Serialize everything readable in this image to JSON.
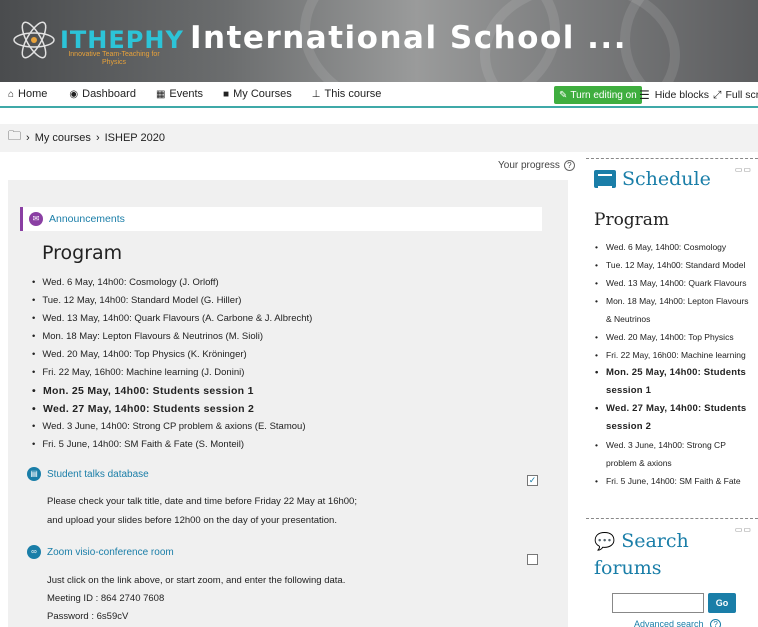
{
  "header": {
    "logo_text": "ITHEPHY",
    "logo_sub": "Innovative Team-Teaching for Physics",
    "site_title": "International School ..."
  },
  "navbar": {
    "items": [
      {
        "label": "Home",
        "icon": "home-icon"
      },
      {
        "label": "Dashboard",
        "icon": "dashboard-icon"
      },
      {
        "label": "Events",
        "icon": "calendar-icon"
      },
      {
        "label": "My Courses",
        "icon": "briefcase-icon"
      },
      {
        "label": "This course",
        "icon": "sitemap-icon"
      }
    ],
    "edit_button": "Turn editing on",
    "hide_blocks": "Hide blocks",
    "full_screen": "Full screen"
  },
  "breadcrumb": {
    "items": [
      "My courses",
      "ISHEP 2020"
    ]
  },
  "progress_label": "Your progress",
  "announcements": {
    "label": "Announcements"
  },
  "program": {
    "title": "Program",
    "items": [
      {
        "text": "Wed. 6 May, 14h00: Cosmology (J. Orloff)",
        "bold": false
      },
      {
        "text": "Tue. 12 May, 14h00: Standard Model (G. Hiller)",
        "bold": false
      },
      {
        "text": "Wed. 13 May, 14h00: Quark Flavours (A. Carbone & J. Albrecht)",
        "bold": false
      },
      {
        "text": "Mon. 18 May: Lepton Flavours & Neutrinos (M. Sioli)",
        "bold": false
      },
      {
        "text": "Wed. 20 May, 14h00: Top Physics (K. Kröninger)",
        "bold": false
      },
      {
        "text": "Fri. 22 May, 16h00: Machine learning (J. Donini)",
        "bold": false
      },
      {
        "text": "Mon. 25 May, 14h00: Students session 1",
        "bold": true
      },
      {
        "text": "Wed. 27 May, 14h00: Students session 2",
        "bold": true
      },
      {
        "text": "Wed. 3 June, 14h00: Strong CP problem & axions (E. Stamou)",
        "bold": false
      },
      {
        "text": "Fri. 5 June, 14h00: SM Faith & Fate (S. Monteil)",
        "bold": false
      }
    ]
  },
  "student_talks": {
    "label": "Student talks database",
    "text1": "Please check your talk title, date and time before Friday 22 May at 16h00;",
    "text2": "and upload your slides before 12h00 on the day of your presentation.",
    "completed": true
  },
  "zoom": {
    "label": "Zoom visio-conference room",
    "text1": "Just click on the link above, or start zoom, and enter the following data.",
    "meeting": "Meeting ID : 864 2740 7608",
    "password": "Password : 6s59cV",
    "completed": false
  },
  "schedule": {
    "title": "Schedule",
    "program_title": "Program",
    "items": [
      {
        "text": "Wed. 6 May, 14h00: Cosmology",
        "bold": false
      },
      {
        "text": "Tue. 12 May, 14h00: Standard Model",
        "bold": false
      },
      {
        "text": "Wed. 13 May, 14h00: Quark Flavours",
        "bold": false
      },
      {
        "text": "Mon. 18 May, 14h00: Lepton Flavours & Neutrinos",
        "bold": false
      },
      {
        "text": "Wed. 20 May, 14h00: Top Physics",
        "bold": false
      },
      {
        "text": "Fri. 22 May, 16h00: Machine learning",
        "bold": false
      },
      {
        "text": "Mon. 25 May, 14h00: Students session 1",
        "bold": true
      },
      {
        "text": "Wed. 27 May, 14h00: Students session 2",
        "bold": true
      },
      {
        "text": "Wed. 3 June, 14h00: Strong CP problem & axions",
        "bold": false
      },
      {
        "text": "Fri. 5 June, 14h00: SM Faith & Fate",
        "bold": false
      }
    ]
  },
  "search_forums": {
    "title": "Search forums",
    "go_label": "Go",
    "advanced": "Advanced search"
  },
  "colors": {
    "accent": "#1a7ea8",
    "edit_green": "#3fae3f",
    "announcement_purple": "#8a3fa3",
    "nav_underline": "#3fa9a8"
  }
}
